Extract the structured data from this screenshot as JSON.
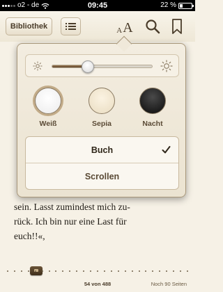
{
  "status_bar": {
    "carrier": "o2 - de",
    "time": "09:45",
    "battery": "22 %",
    "battery_level": 0.22,
    "icons": [
      "signal-icon",
      "wifi-icon",
      "battery-icon"
    ]
  },
  "toolbar": {
    "library_label": "Bibliothek",
    "toc_icon": "list-icon",
    "font_small": "A",
    "font_large": "A",
    "search_icon": "search-icon",
    "bookmark_icon": "bookmark-icon"
  },
  "popover": {
    "brightness": {
      "level": 0.36,
      "min_icon": "sun-small-icon",
      "max_icon": "sun-large-icon"
    },
    "themes": [
      {
        "label": "Weiß",
        "selected": true
      },
      {
        "label": "Sepia",
        "selected": false
      },
      {
        "label": "Nacht",
        "selected": false
      }
    ],
    "modes": [
      {
        "label": "Buch",
        "selected": true
      },
      {
        "label": "Scrollen",
        "selected": false
      }
    ]
  },
  "reader": {
    "lines": [
      "sein. Lasst zumindest mich zu-",
      "rück. Ich bin nur eine Last für",
      "euch!!«,"
    ]
  },
  "footer": {
    "current_page": 54,
    "total_pages": 488,
    "page_label": "54 von 488",
    "pages_remaining": "Noch 90 Seiten",
    "progress": 0.11
  },
  "colors": {
    "page_background": "#f6f1e6",
    "accent_brown": "#5d4329"
  }
}
